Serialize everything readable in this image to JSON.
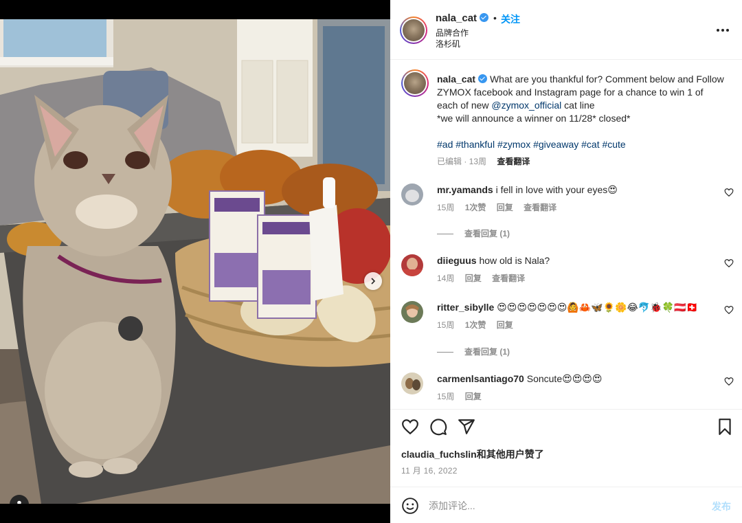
{
  "post": {
    "carousel_dots": 2,
    "carousel_active": 0
  },
  "header": {
    "username": "nala_cat",
    "separator": "•",
    "follow_label": "关注",
    "subtitle": "品牌合作",
    "location": "洛杉矶"
  },
  "caption": {
    "username": "nala_cat",
    "text_1": "What are you thankful for? Comment below and Follow ZYMOX facebook and Instagram page for a chance to win 1 of each of new ",
    "mention": "@zymox_official",
    "text_2": " cat line",
    "text_3": "*we will announce a winner on 11/28* closed*",
    "hashtags": "#ad #thankful #zymox #giveaway #cat #cute",
    "edited": "已编辑 · 13周",
    "translate": "查看翻译"
  },
  "comments": [
    {
      "username": "mr.yamands",
      "text": "i fell in love with your eyes😍",
      "age": "15周",
      "likes": "1次赞",
      "reply": "回复",
      "translate": "查看翻译",
      "replies_label": "查看回复 (1)"
    },
    {
      "username": "diieguus",
      "text": "how old is Nala?",
      "age": "14周",
      "reply": "回复",
      "translate": "查看翻译"
    },
    {
      "username": "ritter_sibylle",
      "text": "😍😍😍😍😍😍😍🙆🦀🦋🌻🌼😂🐬🐞🍀🇦🇹🇨🇭",
      "age": "15周",
      "likes": "1次赞",
      "reply": "回复",
      "replies_label": "查看回复 (1)"
    },
    {
      "username": "carmenlsantiago70",
      "text": "Soncute😍😍😍😍",
      "age": "15周",
      "reply": "回复"
    }
  ],
  "actions": {
    "likes_text": "claudia_fuchslin和其他用户赞了",
    "date": "11 月 16, 2022"
  },
  "composer": {
    "placeholder": "添加评论...",
    "post_label": "发布"
  },
  "colors": {
    "accent": "#0095f6",
    "link": "#00376b",
    "muted": "#8e8e8e",
    "text": "#262626"
  }
}
